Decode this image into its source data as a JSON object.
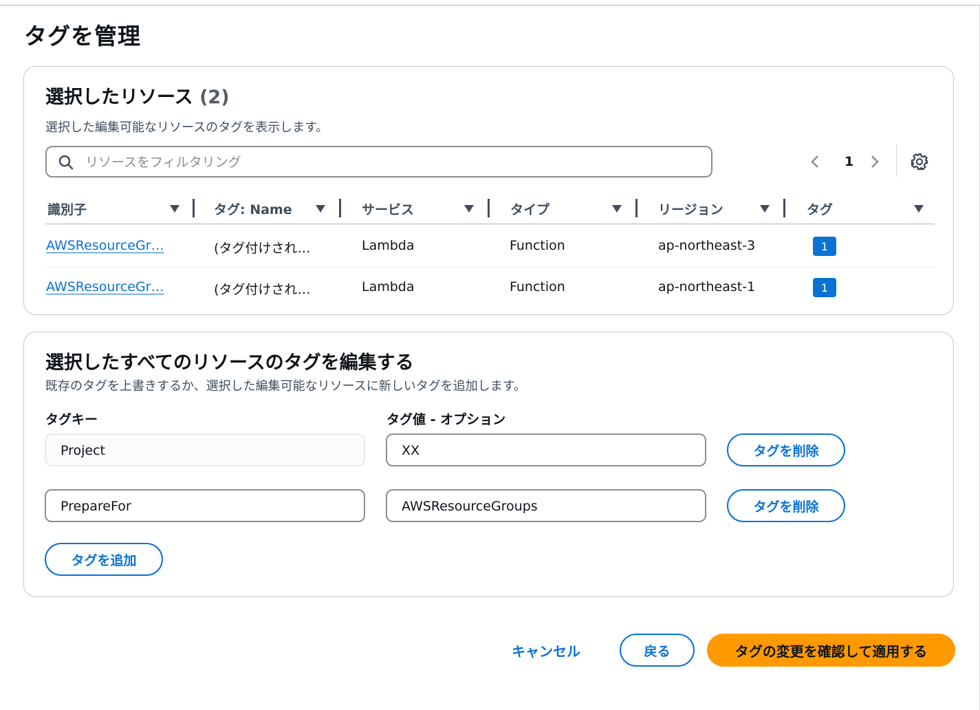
{
  "page": {
    "title": "タグを管理"
  },
  "resources": {
    "heading": "選択したリソース",
    "count": "(2)",
    "description": "選択した編集可能なリソースのタグを表示します。",
    "search": {
      "placeholder": "リソースをフィルタリング"
    },
    "pagination": {
      "current": "1"
    },
    "columns": [
      "識別子",
      "タグ: Name",
      "サービス",
      "タイプ",
      "リージョン",
      "タグ"
    ],
    "rows": [
      {
        "identifier": "AWSResourceGr…",
        "name_tag": "(タグ付けされ…",
        "service": "Lambda",
        "type": "Function",
        "region": "ap-northeast-3",
        "tags": "1"
      },
      {
        "identifier": "AWSResourceGr…",
        "name_tag": "(タグ付けされ…",
        "service": "Lambda",
        "type": "Function",
        "region": "ap-northeast-1",
        "tags": "1"
      }
    ]
  },
  "edit": {
    "heading": "選択したすべてのリソースのタグを編集する",
    "description": "既存のタグを上書きするか、選択した編集可能なリソースに新しいタグを追加します。",
    "key_label": "タグキー",
    "value_label": "タグ値 - オプション",
    "tags": [
      {
        "key": "Project",
        "value": "XX",
        "remove_label": "タグを削除"
      },
      {
        "key": "PrepareFor",
        "value": "AWSResourceGroups",
        "remove_label": "タグを削除"
      }
    ],
    "add_label": "タグを追加"
  },
  "footer": {
    "cancel": "キャンセル",
    "back": "戻る",
    "apply": "タグの変更を確認して適用する"
  },
  "colors": {
    "link": "#0972d3",
    "primary": "#ff9900",
    "border": "#8c8c94"
  }
}
